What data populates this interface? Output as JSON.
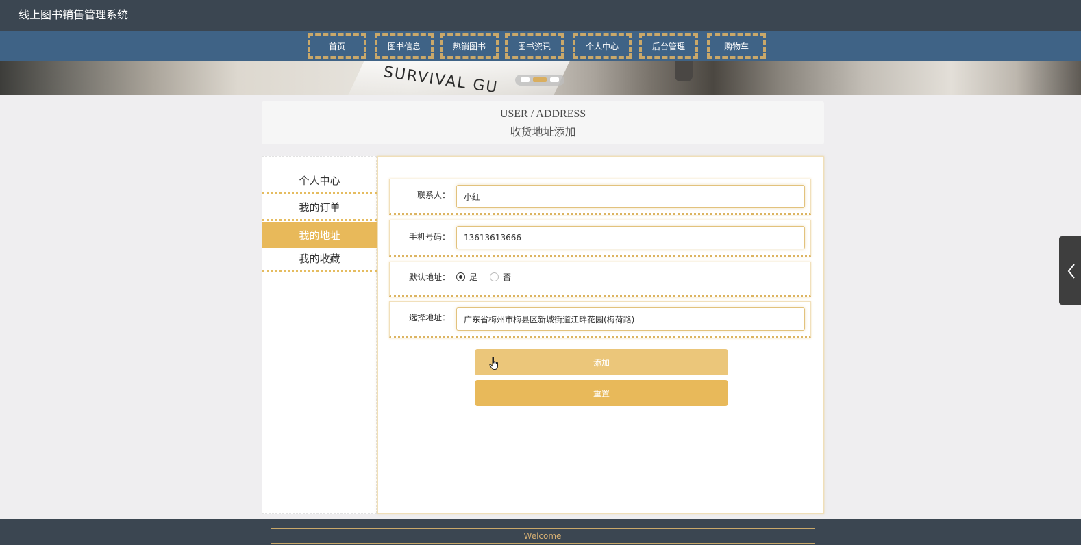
{
  "app": {
    "title": "线上图书销售管理系统"
  },
  "nav": {
    "items": [
      {
        "label": "首页"
      },
      {
        "label": "图书信息"
      },
      {
        "label": "热销图书"
      },
      {
        "label": "图书资讯"
      },
      {
        "label": "个人中心"
      },
      {
        "label": "后台管理"
      },
      {
        "label": "购物车"
      }
    ]
  },
  "banner": {
    "text": "SURVIVAL GU",
    "active_dot": 2,
    "dot_count": 3
  },
  "section": {
    "en": "USER / ADDRESS",
    "cn": "收货地址添加"
  },
  "sidebar": {
    "items": [
      {
        "label": "个人中心"
      },
      {
        "label": "我的订单"
      },
      {
        "label": "我的地址",
        "active": true
      },
      {
        "label": "我的收藏"
      }
    ]
  },
  "form": {
    "contact": {
      "label": "联系人：",
      "value": "小红"
    },
    "phone": {
      "label": "手机号码：",
      "value": "13613613666"
    },
    "default": {
      "label": "默认地址：",
      "options": [
        "是",
        "否"
      ],
      "selected": "是"
    },
    "address": {
      "label": "选择地址：",
      "value": "广东省梅州市梅县区新城街道江畔花园(梅荷路)"
    }
  },
  "buttons": {
    "add": "添加",
    "reset": "重置"
  },
  "footer": {
    "text": "Welcome"
  },
  "colors": {
    "accent": "#e8b95a",
    "topbar": "#3b4651",
    "navbar": "#3f6386"
  },
  "icons": {
    "side_tab": "chevron-left-icon",
    "cursor": "hand-cursor-icon"
  }
}
